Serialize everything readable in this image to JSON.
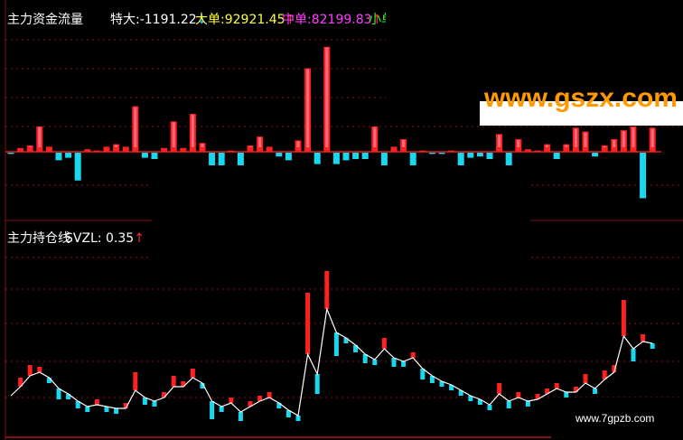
{
  "colors": {
    "background": "#000000",
    "grid": "#8a1010",
    "up_bar": "#ff2020",
    "up_bar_light": "#ff6a80",
    "down_bar": "#18d8f0",
    "line": "#ffffff",
    "label_white": "#ffffff",
    "label_yellow": "#ffff40",
    "label_magenta": "#ff3cff",
    "label_green": "#30ff30",
    "arrow_up": "#ff3030",
    "arrow_down": "#30c8ff",
    "watermark_orange": "#ff9a00"
  },
  "top_panel": {
    "title": "主力资金流量",
    "te_da_label": "特大",
    "te_da_value": ":-1191.22",
    "te_da_arrow": "↓",
    "da_dan_label": "大单",
    "da_dan_value": ":92921.45",
    "da_dan_arrow": "↑",
    "zhong_dan_label": "中单",
    "zhong_dan_value": ":82199.83",
    "zhong_dan_arrow": "↑",
    "xiao_dan_label": "小单"
  },
  "bottom_panel": {
    "title": "主力持仓线",
    "svzl_label": "SVZL",
    "svzl_value": ": 0.35",
    "svzl_arrow": "↑"
  },
  "watermarks": {
    "top_right": "www.gszx.com.cn",
    "bottom_right": "www.7gpzb.com"
  },
  "chart_data": [
    {
      "type": "bar",
      "title": "主力资金流量",
      "series": [
        {
          "name": "主力资金流量",
          "values": [
            -0.1,
            0.3,
            0.5,
            2.0,
            0.4,
            -0.6,
            -0.4,
            -2.2,
            0.2,
            0.1,
            0.4,
            0.6,
            0.4,
            3.6,
            -0.4,
            -0.5,
            0.3,
            2.4,
            0.3,
            3.0,
            0.7,
            -1.0,
            -1.1,
            0.1,
            -1.2,
            0.5,
            1.2,
            0.4,
            -0.3,
            -0.6,
            0.9,
            6.6,
            -0.9,
            8.3,
            -0.9,
            -0.6,
            -0.5,
            -0.5,
            2.0,
            -1.0,
            0.4,
            1.0,
            -1.0,
            0.1,
            -0.1,
            -0.1,
            0.1,
            -1.0,
            -0.4,
            -0.3,
            -0.5,
            1.4,
            -1.0,
            1.0,
            0.2,
            0.1,
            0.6,
            -0.5,
            0.6,
            1.9,
            1.6,
            -0.3,
            0.5,
            1.0,
            1.7,
            2.0,
            -3.6,
            1.9
          ]
        }
      ]
    },
    {
      "type": "line",
      "title": "主力持仓线",
      "series": [
        {
          "name": "SVZL",
          "values": [
            0.5,
            1.0,
            1.6,
            1.8,
            1.5,
            0.9,
            0.6,
            0.2,
            -0.1,
            0.0,
            -0.1,
            -0.2,
            -0.2,
            0.8,
            0.4,
            0.2,
            0.4,
            1.0,
            1.0,
            1.5,
            1.2,
            0.2,
            -0.1,
            0.1,
            -0.4,
            -0.1,
            0.2,
            0.4,
            0.1,
            -0.3,
            -0.6,
            2.8,
            1.7,
            5.3,
            4.0,
            3.7,
            3.3,
            2.8,
            2.5,
            3.1,
            2.6,
            2.4,
            2.6,
            2.0,
            1.6,
            1.3,
            1.1,
            0.8,
            0.5,
            0.3,
            0.0,
            0.6,
            0.2,
            0.4,
            0.2,
            0.3,
            0.6,
            0.9,
            0.7,
            0.7,
            1.2,
            0.9,
            1.4,
            1.8,
            3.8,
            3.1,
            3.5,
            3.4
          ]
        }
      ]
    }
  ]
}
